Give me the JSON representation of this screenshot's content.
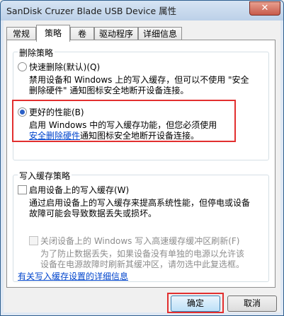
{
  "window": {
    "title": "SanDisk Cruzer Blade USB Device 属性",
    "close": "✕"
  },
  "tabs": [
    "常规",
    "策略",
    "卷",
    "驱动程序",
    "详细信息"
  ],
  "removal": {
    "group_label": "删除策略",
    "quick": {
      "label": "快速删除(默认)(Q)",
      "desc1": "禁用设备和 Windows 上的写入缓存，但可以不使用 \"安全",
      "desc2": "删除硬件\" 通知图标安全地断开设备连接。"
    },
    "better": {
      "label": "更好的性能(B)",
      "desc1": "启用 Windows 中的写入缓存功能，但您必须使用",
      "link": "安全删除硬件",
      "desc2_rest": "通知图标安全地断开设备连接。"
    }
  },
  "write_cache": {
    "group_label": "写入缓存策略",
    "enable": {
      "label": "启用设备上的写入缓存(W)",
      "desc1": "通过启用设备上的写入缓存来提高系统性能，但停电或设备",
      "desc2": "故障可能会导致数据丢失或损坏。"
    },
    "flush": {
      "label": "关闭设备上的 Windows 写入高速缓存缓冲区刷新(F)",
      "desc1": "为了防止数据丢失，如果设备没有单独的电源以允许该",
      "desc2": "设备在电源故障时刷新其缓冲区，请勿选中此复选框。"
    },
    "details_link": "有关写入缓存设置的详细信息"
  },
  "buttons": {
    "ok": "确定",
    "cancel": "取消"
  }
}
